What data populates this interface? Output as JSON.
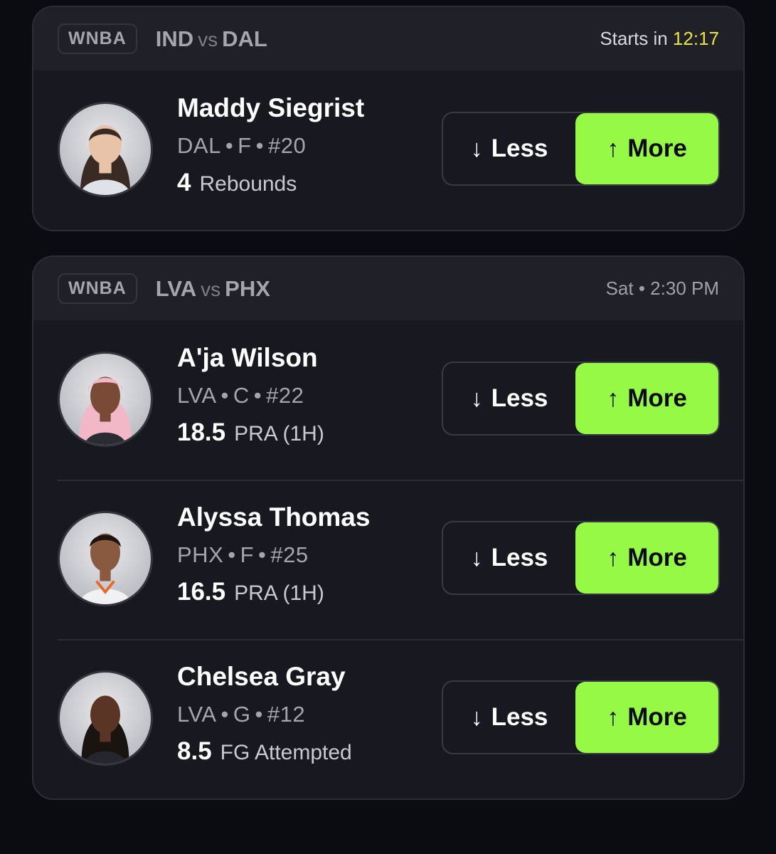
{
  "colors": {
    "accent_more": "#96f945",
    "countdown": "#ebe435",
    "background": "#0b0c12",
    "card": "#181920"
  },
  "less_label": "Less",
  "more_label": "More",
  "less_icon": "arrow-down-icon",
  "more_icon": "arrow-up-icon",
  "cards": [
    {
      "league": "WNBA",
      "team_a": "IND",
      "vs": "vs",
      "team_b": "DAL",
      "time_prefix": "Starts in",
      "time_value": "12:17",
      "players": [
        {
          "name": "Maddy Siegrist",
          "team": "DAL",
          "position": "F",
          "number": "#20",
          "line": "4",
          "stat": "Rebounds"
        }
      ]
    },
    {
      "league": "WNBA",
      "team_a": "LVA",
      "vs": "vs",
      "team_b": "PHX",
      "time_text": "Sat • 2:30 PM",
      "players": [
        {
          "name": "A'ja Wilson",
          "team": "LVA",
          "position": "C",
          "number": "#22",
          "line": "18.5",
          "stat": "PRA (1H)"
        },
        {
          "name": "Alyssa Thomas",
          "team": "PHX",
          "position": "F",
          "number": "#25",
          "line": "16.5",
          "stat": "PRA (1H)"
        },
        {
          "name": "Chelsea Gray",
          "team": "LVA",
          "position": "G",
          "number": "#12",
          "line": "8.5",
          "stat": "FG Attempted"
        }
      ]
    }
  ]
}
